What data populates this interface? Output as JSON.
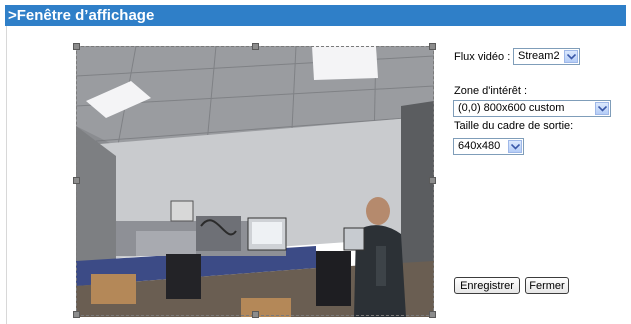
{
  "header": {
    "title": ">Fenêtre d’affichage"
  },
  "controls": {
    "stream_label": "Flux vidéo :",
    "stream_value": "Stream2",
    "zone_label": "Zone d'intérêt :",
    "zone_value": "(0,0) 800x600 custom",
    "output_label": "Taille du cadre de sortie:",
    "output_value": "640x480"
  },
  "buttons": {
    "save": "Enregistrer",
    "close": "Fermer"
  },
  "colors": {
    "header_bg": "#2f7fc8",
    "header_text": "#ffffff"
  }
}
